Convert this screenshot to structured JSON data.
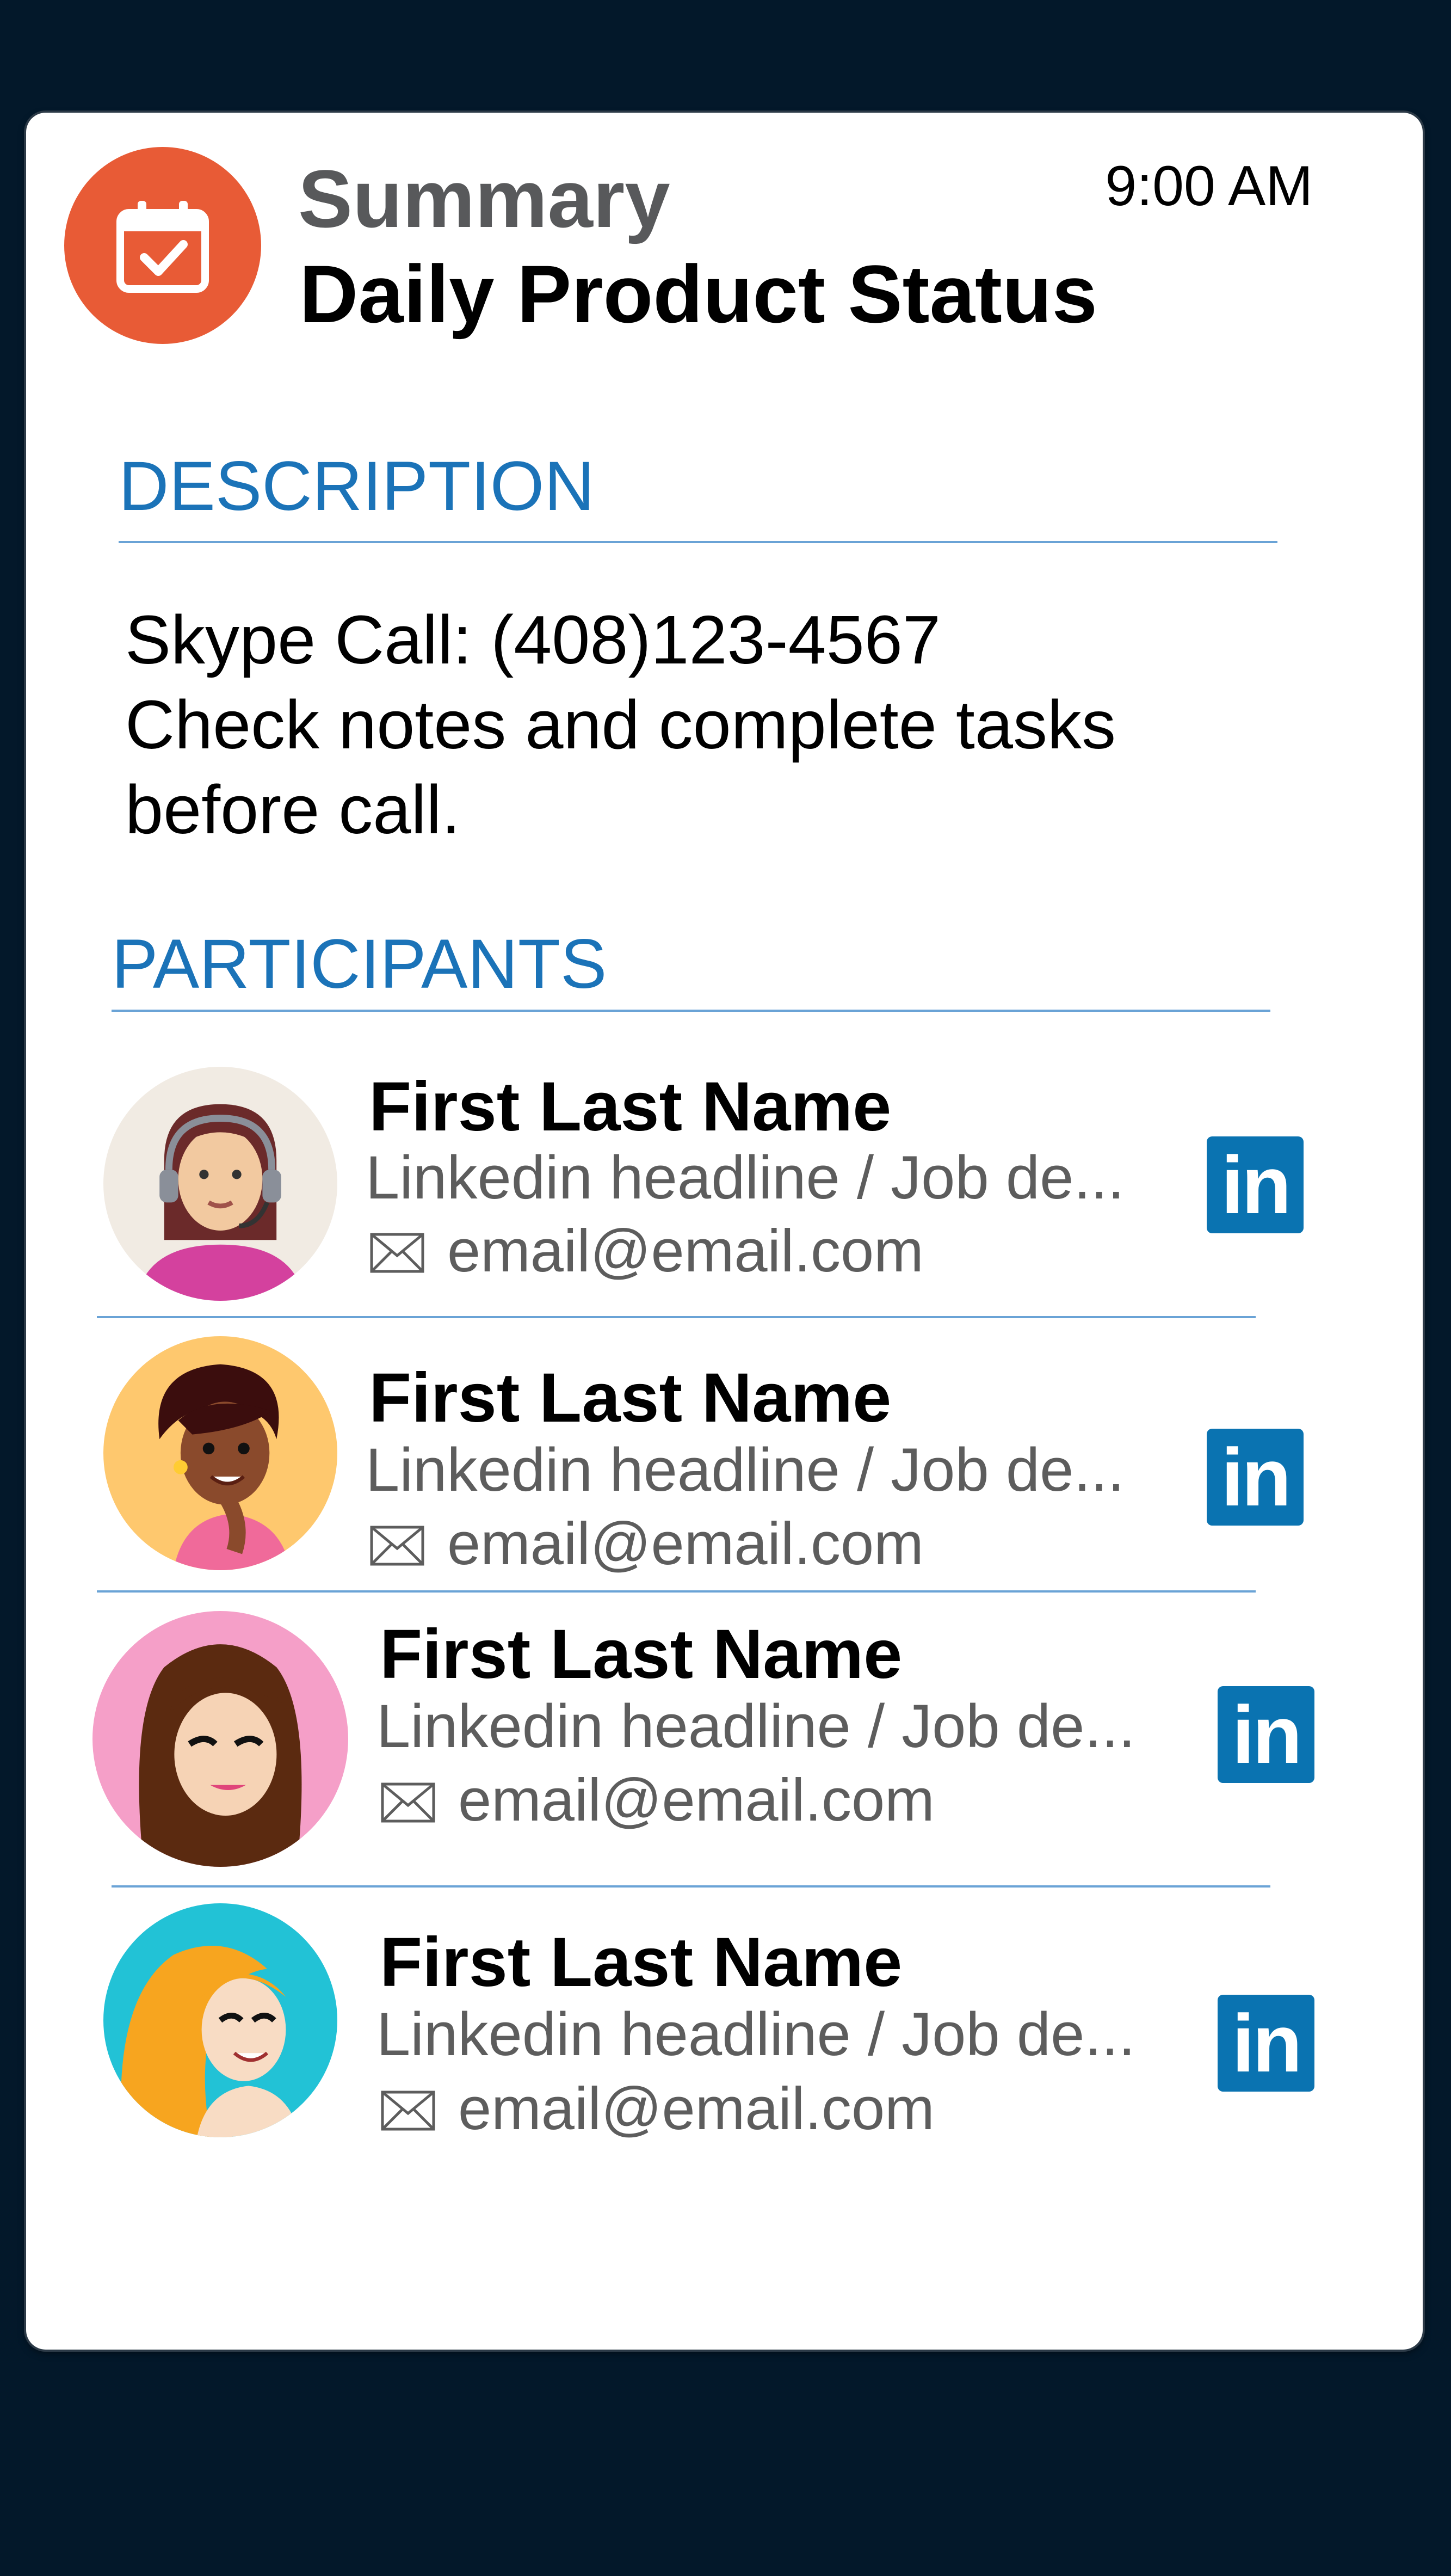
{
  "header": {
    "title": "Summary",
    "subtitle": "Daily Product Status",
    "time": "9:00 AM",
    "icon": "calendar-check-icon",
    "badge_color": "#e85b36"
  },
  "description": {
    "heading": "DESCRIPTION",
    "lines": [
      "Skype Call: (408)123-4567",
      "Check notes and complete tasks",
      "before call."
    ]
  },
  "participants": {
    "heading": "PARTICIPANTS",
    "items": [
      {
        "name": "First Last Name",
        "headline": "Linkedin headline / Job de...",
        "email": "email@email.com",
        "linkedin": "in",
        "avatar_bg": "#f1ebe3"
      },
      {
        "name": "First Last Name",
        "headline": "Linkedin headline / Job de...",
        "email": "email@email.com",
        "linkedin": "in",
        "avatar_bg": "#fec86e"
      },
      {
        "name": "First Last Name",
        "headline": "Linkedin headline / Job de...",
        "email": "email@email.com",
        "linkedin": "in",
        "avatar_bg": "#f59fc8"
      },
      {
        "name": "First Last Name",
        "headline": "Linkedin headline / Job de...",
        "email": "email@email.com",
        "linkedin": "in",
        "avatar_bg": "#22c2d6"
      }
    ]
  },
  "colors": {
    "background": "#03182a",
    "accent": "#1b73b8",
    "linkedin": "#0a73b1"
  }
}
